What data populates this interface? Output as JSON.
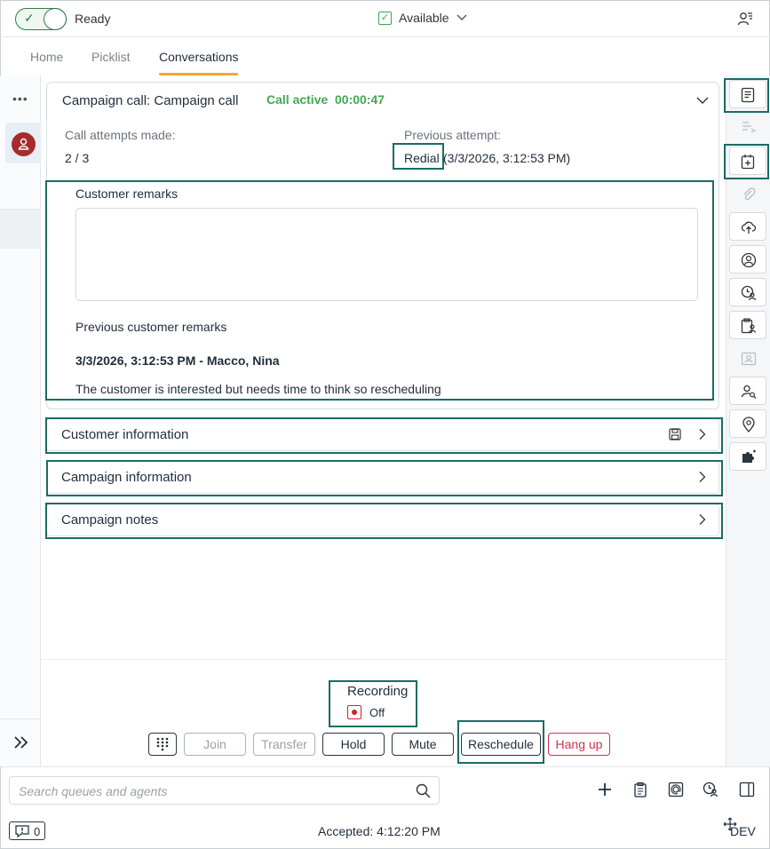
{
  "status": {
    "state_label": "Ready",
    "availability": "Available"
  },
  "tabs": [
    {
      "label": "Home"
    },
    {
      "label": "Picklist"
    },
    {
      "label": "Conversations"
    }
  ],
  "call": {
    "title": "Campaign call: Campaign call",
    "status_label": "Call active",
    "timer": "00:00:47",
    "attempts_label": "Call attempts made:",
    "attempts_value": "2 / 3",
    "previous_attempt_label": "Previous attempt:",
    "previous_attempt_type": "Redial",
    "previous_attempt_time": "(3/3/2026, 3:12:53 PM)",
    "customer_remarks_title": "Customer remarks",
    "customer_remarks_value": "",
    "previous_remarks_title": "Previous customer remarks",
    "previous_remark_header": "3/3/2026, 3:12:53 PM - Macco, Nina",
    "previous_remark_text": "The customer is interested but needs time to think so rescheduling"
  },
  "sections": [
    {
      "label": "Customer information"
    },
    {
      "label": "Campaign information"
    },
    {
      "label": "Campaign notes"
    }
  ],
  "recording": {
    "title": "Recording",
    "state": "Off"
  },
  "controls": {
    "join": "Join",
    "transfer": "Transfer",
    "hold": "Hold",
    "mute": "Mute",
    "reschedule": "Reschedule",
    "hangup": "Hang up"
  },
  "footer": {
    "search_placeholder": "Search queues and agents",
    "notification_count": "0",
    "accepted": "Accepted: 4:12:20 PM",
    "env": "DEV"
  },
  "right_rail_icons": [
    "script-icon",
    "transcript-icon",
    "calendar-add-icon",
    "attachment-icon",
    "cloud-upload-icon",
    "contact-icon",
    "contact-history-icon",
    "clipboard-contact-icon",
    "contact-card-icon",
    "contact-search-icon",
    "location-icon",
    "puzzle-icon"
  ],
  "colors": {
    "accent_green": "#43a854",
    "highlight": "#1b6b66",
    "tab_underline": "#f0a73a",
    "danger": "#d2314f"
  }
}
